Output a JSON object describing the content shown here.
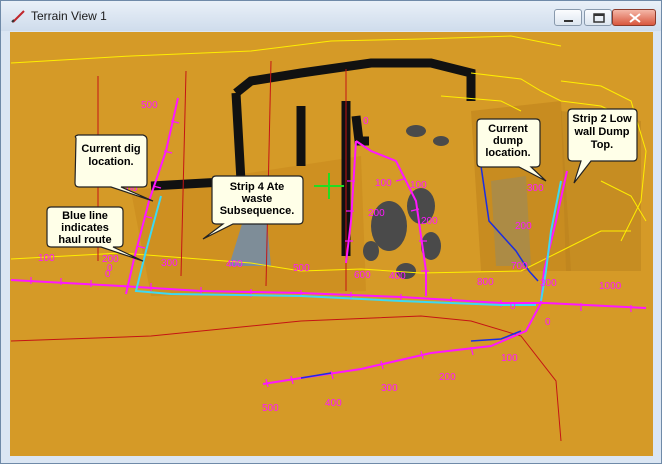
{
  "window": {
    "title": "Terrain View 1"
  },
  "callouts": {
    "dig": [
      "Current dig",
      "location."
    ],
    "haul": [
      "Blue line",
      "indicates",
      "haul route"
    ],
    "strip4": [
      "Strip 4 Ate",
      "waste",
      "Subsequence."
    ],
    "dump": [
      "Current",
      "dump",
      "location."
    ],
    "strip2": [
      "Strip 2 Low",
      "wall Dump",
      "Top."
    ]
  },
  "labels": {
    "l500a": "500",
    "l100a": "100",
    "l200a": "200",
    "l0a": "0",
    "l300a": "300",
    "l400a": "400",
    "l500b": "500",
    "l600": "600",
    "l0b": "0",
    "l100b": "100",
    "l100c": "100",
    "l200b": "200",
    "l200c": "200",
    "l400b": "400",
    "l800": "800",
    "l300b": "300",
    "l200d": "200",
    "l700": "700",
    "l0c": "0",
    "l300c": "300",
    "l1000": "1000",
    "l0d": "0",
    "l100d": "100",
    "l200e": "200",
    "l300d": "300",
    "l400c": "400",
    "l500c": "500",
    "l0e": "0",
    "l100e": "100"
  },
  "colors": {
    "terrain": "#d59a27",
    "pit": "#111111",
    "ramp": "#ff17ff",
    "haul": "#3dd9f2",
    "blue_route": "#1b2ee0",
    "contour": "#ffee00",
    "boundary": "#dd1111",
    "cursor": "#22dd22"
  },
  "icons": {
    "app": "pencil-icon",
    "minimize": "minimize-icon",
    "maximize": "maximize-icon",
    "close": "close-icon"
  }
}
